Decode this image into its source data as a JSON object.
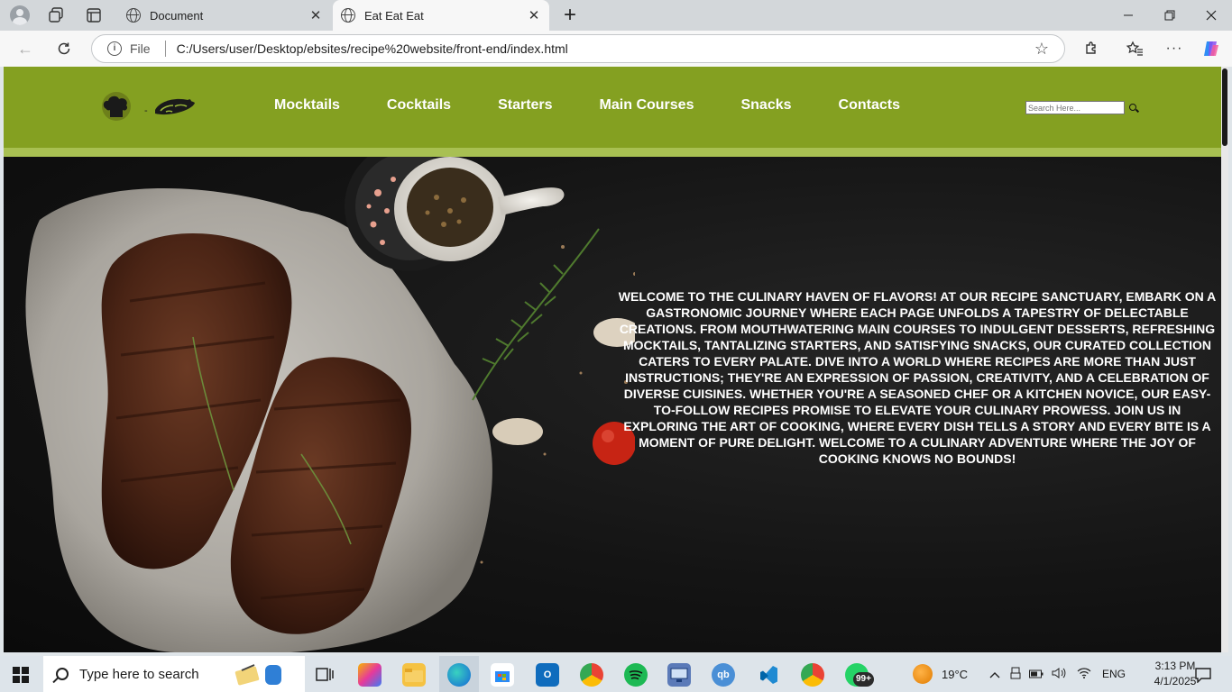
{
  "browser": {
    "tabs": [
      {
        "title": "Document",
        "active": false
      },
      {
        "title": "Eat Eat Eat",
        "active": true
      }
    ],
    "address": {
      "scheme_label": "File",
      "url": "C:/Users/user/Desktop/ebsites/recipe%20website/front-end/index.html"
    }
  },
  "site": {
    "colors": {
      "header": "#84a021",
      "header_stripe": "#a8c052",
      "hero_bg": "#111111"
    },
    "logo_alt": "Foodify",
    "nav": [
      "Mocktails",
      "Cocktails",
      "Starters",
      "Main Courses",
      "Snacks",
      "Contacts"
    ],
    "search": {
      "placeholder": "Search Here..."
    },
    "hero_text": "Welcome to the culinary haven of flavors! At our recipe sanctuary, embark on a gastronomic journey where each page unfolds a tapestry of delectable creations. From mouthwatering main courses to indulgent desserts, refreshing mocktails, tantalizing starters, and satisfying snacks, our curated collection caters to every palate. Dive into a world where recipes are more than just instructions; they're an expression of passion, creativity, and a celebration of diverse cuisines. Whether you're a seasoned chef or a kitchen novice, our easy-to-follow recipes promise to elevate your culinary prowess. Join us in exploring the art of cooking, where every dish tells a story and every bite is a moment of pure delight. Welcome to a culinary adventure where the joy of cooking knows no bounds!"
  },
  "taskbar": {
    "search_placeholder": "Type here to search",
    "notification_badge": "99+",
    "weather": "19°C",
    "language": "ENG",
    "time": "3:13 PM",
    "date": "4/1/2025"
  }
}
